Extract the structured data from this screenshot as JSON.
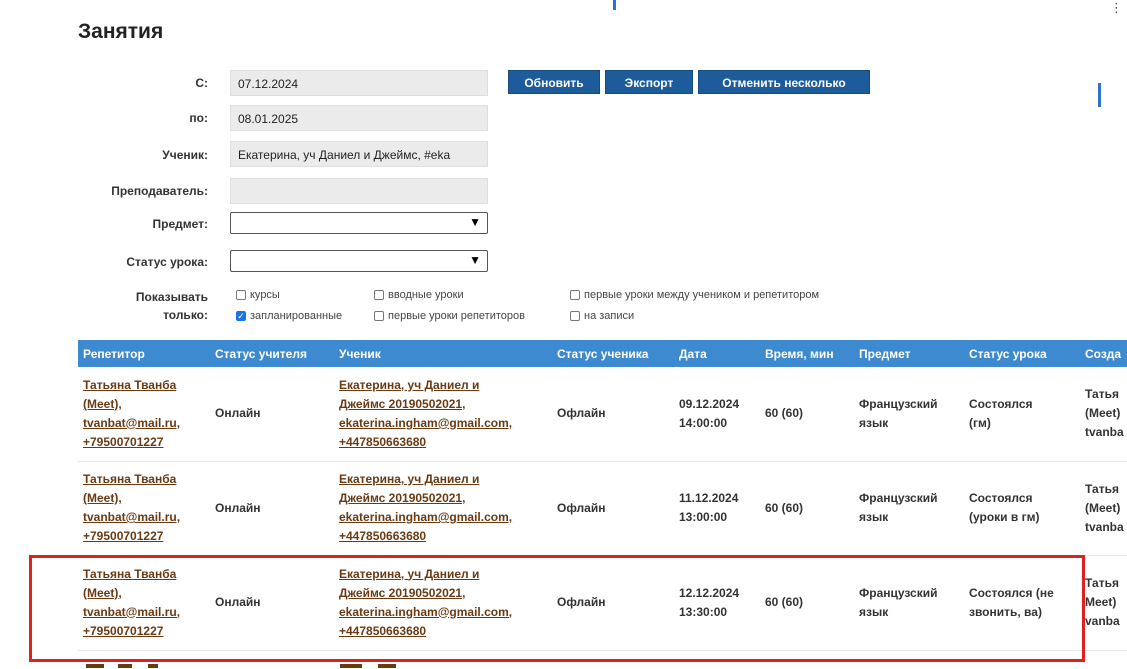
{
  "page": {
    "title": "Занятия"
  },
  "filters": {
    "from_label": "С:",
    "from_value": "07.12.2024",
    "to_label": "по:",
    "to_value": "08.01.2025",
    "student_label": "Ученик:",
    "student_value": "Екатерина, уч Даниел и Джеймс, #eka",
    "teacher_label": "Преподаватель:",
    "teacher_value": "",
    "subject_label": "Предмет:",
    "status_label": "Статус урока:",
    "show_only_label_1": "Показывать",
    "show_only_label_2": "только:"
  },
  "buttons": {
    "refresh": "Обновить",
    "export": "Экспорт",
    "cancel_many": "Отменить несколько"
  },
  "checkboxes": [
    {
      "label": "курсы",
      "checked": false
    },
    {
      "label": "вводные уроки",
      "checked": false
    },
    {
      "label": "первые уроки между учеником и репетитором",
      "checked": false
    },
    {
      "label": "запланированные",
      "checked": true
    },
    {
      "label": "первые уроки репетиторов",
      "checked": false
    },
    {
      "label": "на записи",
      "checked": false
    }
  ],
  "table": {
    "headers": [
      "Репетитор",
      "Статус учителя",
      "Ученик",
      "Статус ученика",
      "Дата",
      "Время, мин",
      "Предмет",
      "Статус урока",
      "Созда"
    ],
    "rows": [
      {
        "tutor": [
          "Татьяна Тванба",
          "(Meet),",
          "tvanbat@mail.ru,",
          "+79500701227"
        ],
        "teacher_status": "Онлайн",
        "student": [
          "Екатерина, уч Даниел и",
          "Джеймс 20190502021,",
          "ekaterina.ingham@gmail.com,",
          "+447850663680"
        ],
        "student_status": "Офлайн",
        "date": [
          "09.12.2024",
          "14:00:00"
        ],
        "duration": "60 (60)",
        "subject": [
          "Французский",
          "язык"
        ],
        "lesson_status": [
          "Состоялся",
          "(гм)"
        ],
        "creator": [
          "Татья",
          "(Meet)",
          "tvanba"
        ]
      },
      {
        "tutor": [
          "Татьяна Тванба",
          "(Meet),",
          "tvanbat@mail.ru,",
          "+79500701227"
        ],
        "teacher_status": "Онлайн",
        "student": [
          "Екатерина, уч Даниел и",
          "Джеймс 20190502021,",
          "ekaterina.ingham@gmail.com,",
          "+447850663680"
        ],
        "student_status": "Офлайн",
        "date": [
          "11.12.2024",
          "13:00:00"
        ],
        "duration": "60 (60)",
        "subject": [
          "Французский",
          "язык"
        ],
        "lesson_status": [
          "Состоялся",
          "(уроки в гм)"
        ],
        "creator": [
          "Татья",
          "(Meet)",
          "tvanba"
        ]
      },
      {
        "tutor": [
          "Татьяна Тванба",
          "(Meet),",
          "tvanbat@mail.ru,",
          "+79500701227"
        ],
        "teacher_status": "Онлайн",
        "student": [
          "Екатерина, уч Даниел и",
          "Джеймс 20190502021,",
          "ekaterina.ingham@gmail.com,",
          "+447850663680"
        ],
        "student_status": "Офлайн",
        "date": [
          "12.12.2024",
          "13:30:00"
        ],
        "duration": "60 (60)",
        "subject": [
          "Французский",
          "язык"
        ],
        "lesson_status": [
          "Состоялся (не",
          "звонить, ва)"
        ],
        "creator": [
          "Татья",
          "Meet)",
          "vanba"
        ]
      }
    ]
  },
  "colors": {
    "header_bg": "#3d8ad0",
    "button_bg": "#1e5b9a",
    "link": "#6b3a12",
    "online": "#1e8a1e",
    "offline": "#e02020",
    "highlight": "#e02020"
  },
  "icons": {
    "select_arrow": "chevron-down-icon",
    "menu": "kebab-menu-icon"
  }
}
